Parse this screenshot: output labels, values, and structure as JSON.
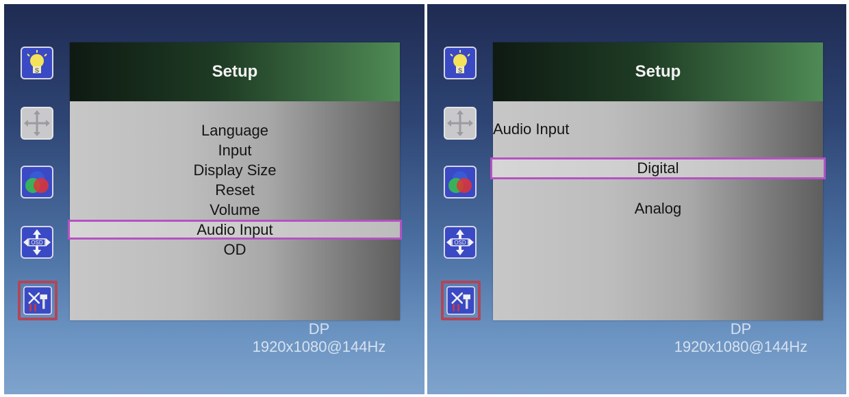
{
  "screens": [
    {
      "menu": {
        "title": "Setup",
        "items": [
          "Language",
          "Input",
          "Display Size",
          "Reset",
          "Volume",
          "Audio Input",
          "OD"
        ],
        "selected_item": "Audio Input"
      },
      "status": {
        "source": "DP",
        "resolution": "1920x1080@144Hz"
      }
    },
    {
      "menu": {
        "title": "Setup",
        "submenu_title": "Audio Input",
        "options": [
          "Digital",
          "Analog"
        ],
        "selected_option": "Digital"
      },
      "status": {
        "source": "DP",
        "resolution": "1920x1080@144Hz"
      }
    }
  ],
  "sidebar_icons": [
    "luminance-icon",
    "image-position-icon",
    "color-icon",
    "osd-position-icon",
    "setup-tools-icon"
  ],
  "sidebar_active": "setup-tools-icon",
  "colors": {
    "selection_border": "#b552c2",
    "active_icon_border": "#b24658",
    "header_green": "#4f8a55"
  }
}
